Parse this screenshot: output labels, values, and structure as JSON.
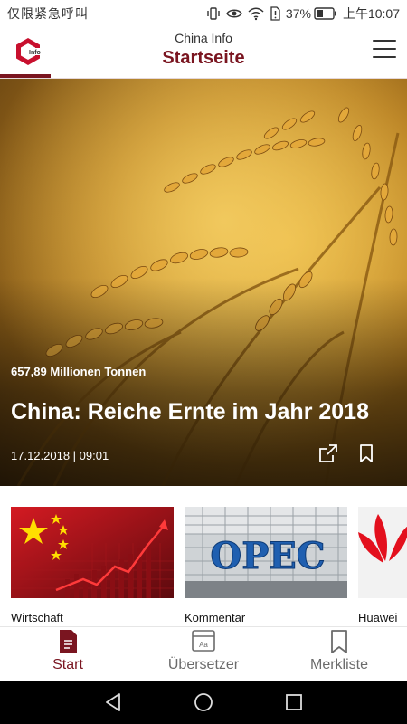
{
  "status_bar": {
    "carrier_text": "仅限紧急呼叫",
    "battery_percent": "37%",
    "time": "上午10:07"
  },
  "header": {
    "app_name": "China Info",
    "page_title": "Startseite",
    "logo_text": "Info"
  },
  "hero": {
    "kicker": "657,89 Millionen Tonnen",
    "headline": "China: Reiche Ernte im Jahr 2018",
    "date": "17.12.2018 | 09:01"
  },
  "carousel": {
    "items": [
      {
        "label": "Wirtschaft"
      },
      {
        "label": "Kommentar",
        "image_text": "OPEC"
      },
      {
        "label": "Huawei"
      }
    ]
  },
  "bottom_nav": {
    "items": [
      {
        "label": "Start",
        "icon": "document-icon",
        "active": true
      },
      {
        "label": "Übersetzer",
        "icon": "translator-icon",
        "active": false
      },
      {
        "label": "Merkliste",
        "icon": "bookmark-icon",
        "active": false
      }
    ]
  },
  "colors": {
    "brand": "#7a1520",
    "inactive": "#6b6b6b"
  }
}
